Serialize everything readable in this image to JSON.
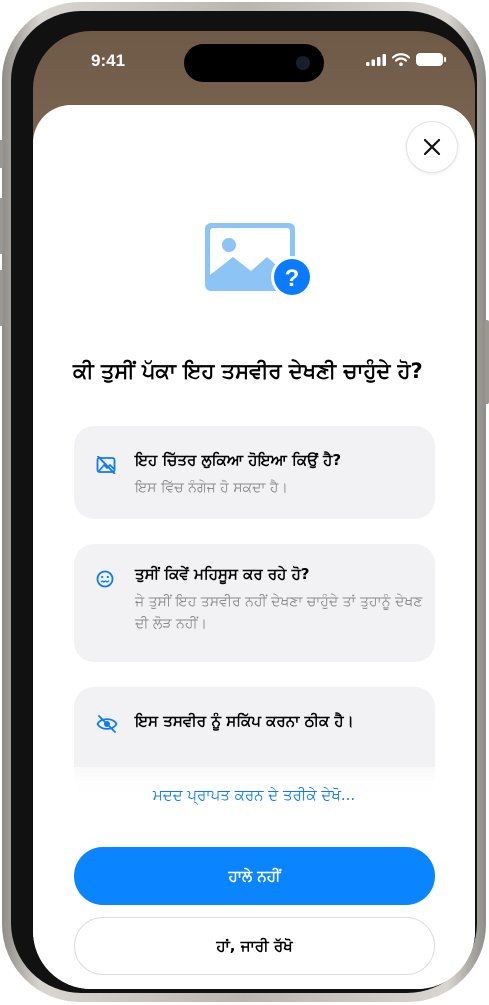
{
  "status_bar": {
    "time": "9:41"
  },
  "sheet": {
    "title": "ਕੀ ਤੁਸੀਂ ਪੱਕਾ ਇਹ ਤਸਵੀਰ ਦੇਖਣੀ ਚਾਹੁੰਦੇ ਹੋ?",
    "cards": [
      {
        "icon": "hidden-image-icon",
        "title": "ਇਹ ਚਿੱਤਰ ਲੁਕਿਆ ਹੋਇਆ ਕਿਉਂ ਹੈ?",
        "body": "ਇਸ ਵਿੱਚ ਨੰਗੇਜ ਹੋ ਸਕਦਾ ਹੈ।"
      },
      {
        "icon": "anxious-face-icon",
        "title": "ਤੁਸੀਂ ਕਿਵੇਂ ਮਹਿਸੂਸ ਕਰ ਰਹੇ ਹੋ?",
        "body": "ਜੇ ਤੁਸੀਂ ਇਹ ਤਸਵੀਰ ਨਹੀਂ ਦੇਖਣਾ ਚਾਹੁੰਦੇ ਤਾਂ ਤੁਹਾਨੂੰ ਦੇਖਣ ਦੀ ਲੋੜ ਨਹੀਂ।"
      },
      {
        "icon": "eye-slash-icon",
        "title": "ਇਸ ਤਸਵੀਰ ਨੂੰ ਸਕਿੱਪ ਕਰਨਾ ਠੀਕ ਹੈ।"
      }
    ],
    "help_link": "ਮਦਦ ਪ੍ਰਾਪਤ ਕਰਨ ਦੇ ਤਰੀਕੇ ਦੇਖੋ...",
    "primary_button": "ਹਾਲੇ ਨਹੀਂ",
    "secondary_button": "ਹਾਂ, ਜਾਰੀ ਰੱਖੋ"
  },
  "colors": {
    "accent": "#0a84ff",
    "link": "#0a7aff",
    "card_bg": "#f2f2f4",
    "secondary_text": "#8a8a8e"
  }
}
